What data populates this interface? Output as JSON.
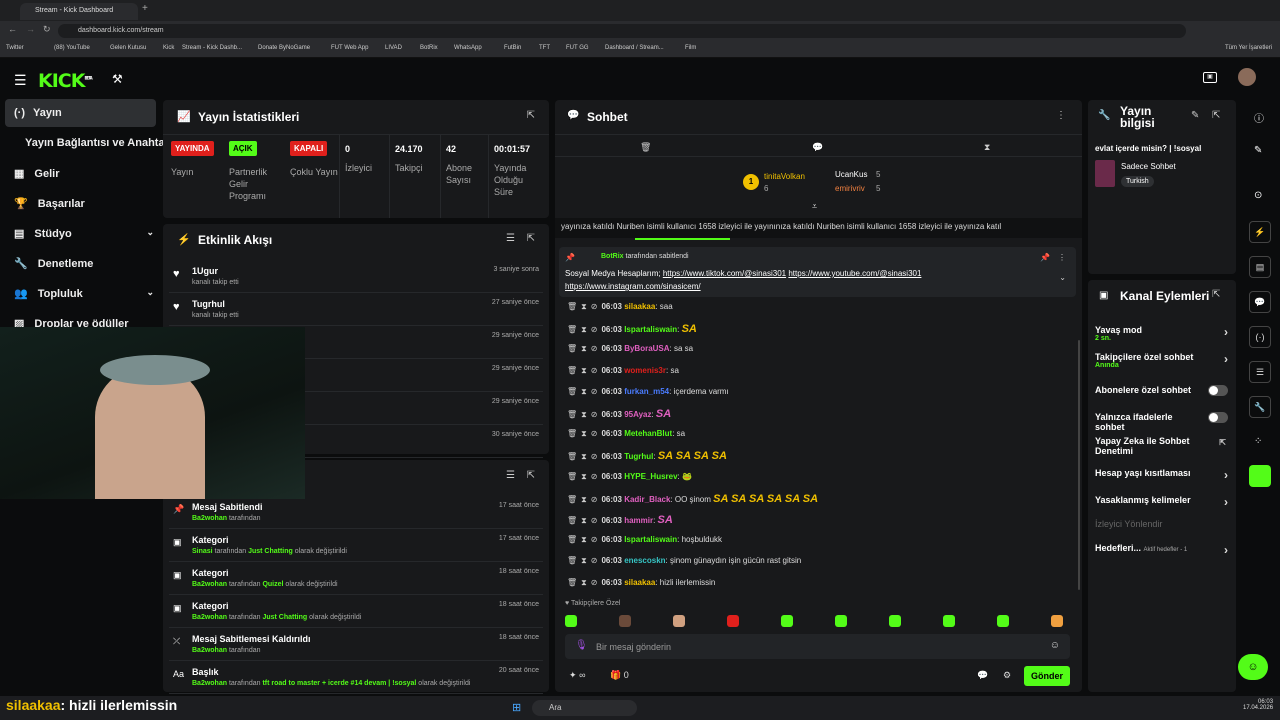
{
  "browser": {
    "tab_title": "Stream - Kick Dashboard",
    "url": "dashboard.kick.com/stream",
    "bookmarks": [
      "Twitter",
      "(88) YouTube",
      "Gelen Kutusu",
      "Kick",
      "Stream - Kick Dashb...",
      "Donate ByNoGame",
      "FUT Web App",
      "LIVAD",
      "BotRix",
      "WhatsApp",
      "FutBin",
      "TFT",
      "FUT GG",
      "Dashboard / Stream...",
      "Film"
    ],
    "all_bookmarks": "Tüm Yer İşaretleri"
  },
  "brand": {
    "logo": "KICK",
    "beta": "BETA",
    "accent": "#53fc18"
  },
  "sidebar": {
    "items": [
      {
        "label": "Yayın",
        "icon": "broadcast-icon"
      },
      {
        "label": "Yayın Bağlantısı ve Anahtarı"
      },
      {
        "label": "Gelir",
        "icon": "revenue-icon"
      },
      {
        "label": "Başarılar",
        "icon": "trophy-icon"
      },
      {
        "label": "Stüdyo",
        "icon": "studio-icon"
      },
      {
        "label": "Denetleme",
        "icon": "wrench-icon"
      },
      {
        "label": "Topluluk",
        "icon": "community-icon"
      },
      {
        "label": "Droplar ve ödüller",
        "icon": "gift-icon"
      }
    ]
  },
  "stats": {
    "title": "Yayın İstatistikleri",
    "badges": [
      {
        "badge": "YAYINDA",
        "label": "Yayın",
        "color": "#e0201c"
      },
      {
        "badge": "AÇIK",
        "label": "Partnerlik Gelir Programı",
        "color": "#53fc18"
      },
      {
        "badge": "KAPALI",
        "label": "Çoklu Yayın",
        "color": "#e0201c"
      }
    ],
    "values": [
      {
        "value": "0",
        "label": "İzleyici"
      },
      {
        "value": "24.170",
        "label": "Takipçi"
      },
      {
        "value": "42",
        "label": "Abone Sayısı"
      },
      {
        "value": "00:01:57",
        "label": "Yayında Olduğu Süre"
      }
    ]
  },
  "activity": {
    "title": "Etkinlik Akışı",
    "events": [
      {
        "name": "1Ugur",
        "sub": "kanalı takip etti",
        "time": "3 saniye sonra"
      },
      {
        "name": "Tugrhul",
        "sub": "kanalı takip etti",
        "time": "27 saniye önce"
      },
      {
        "name": "",
        "sub": "",
        "time": "29 saniye önce"
      },
      {
        "name": "",
        "sub": "",
        "time": "29 saniye önce"
      },
      {
        "name": "",
        "sub": "",
        "time": "29 saniye önce"
      },
      {
        "name": "",
        "sub": "",
        "time": "30 saniye önce"
      }
    ]
  },
  "modlog": {
    "events": [
      {
        "title": "Mesaj Sabitlendi",
        "who": "Ba2wohan",
        "rest": "tarafından",
        "extra": "",
        "tail": "",
        "time": "17 saat önce"
      },
      {
        "title": "Kategori",
        "who": "Sinasi",
        "rest": "tarafından",
        "extra": "Just Chatting",
        "tail": "olarak değiştirildi",
        "time": "17 saat önce"
      },
      {
        "title": "Kategori",
        "who": "Ba2wohan",
        "rest": "tarafından",
        "extra": "Quizel",
        "tail": "olarak değiştirildi",
        "time": "18 saat önce"
      },
      {
        "title": "Kategori",
        "who": "Ba2wohan",
        "rest": "tarafından",
        "extra": "Just Chatting",
        "tail": "olarak değiştirildi",
        "time": "18 saat önce"
      },
      {
        "title": "Mesaj Sabitlemesi Kaldırıldı",
        "who": "Ba2wohan",
        "rest": "tarafından",
        "extra": "",
        "tail": "",
        "time": "18 saat önce"
      },
      {
        "title": "Başlık",
        "who": "Ba2wohan",
        "rest": "tarafından",
        "extra": "tft road to master + icerde #14 devam | !sosyal",
        "tail": "olarak değiştirildi",
        "time": "20 saat önce"
      }
    ]
  },
  "chat": {
    "title": "Sohbet",
    "top_gifters": [
      {
        "name": "tinitaVolkan",
        "count": "6",
        "rank": "1"
      },
      {
        "name": "UcanKus",
        "count": "5"
      },
      {
        "name": "emirivriv",
        "count": "5"
      }
    ],
    "ticker": "yayınıza katıldı  Nuriben isimli kullanıcı 1658 izleyici ile yayınınıza katıldı  Nuriben isimli kullanıcı 1658 izleyici ile yayınıza katıl",
    "pinned_by": "BotRix",
    "pinned_suffix": "tarafından sabitlendi",
    "pinned_text": "Sosyal Medya Hesaplarım;",
    "pinned_link1": "https://www.tiktok.com/@sinasi301",
    "pinned_link2": "https://www.youtube.com/@sinasi301",
    "pinned_link3": "https://www.instagram.com/sinasicem/",
    "messages": [
      {
        "time": "06:03",
        "user": "silaakaa",
        "color": "#f0c000",
        "text": "saa"
      },
      {
        "time": "06:03",
        "user": "Ispartaliswain",
        "color": "#53fc18",
        "text": "SA",
        "emote": "sa"
      },
      {
        "time": "06:03",
        "user": "ByBoraUSA",
        "color": "#e060c0",
        "text": "sa sa"
      },
      {
        "time": "06:03",
        "user": "womenis3r",
        "color": "#e0201c",
        "text": "sa"
      },
      {
        "time": "06:03",
        "user": "furkan_m54",
        "color": "#4a7cff",
        "text": "içerdema varmı"
      },
      {
        "time": "06:03",
        "user": "95Ayaz",
        "color": "#e060c0",
        "text": "SA",
        "emote": "sa-p"
      },
      {
        "time": "06:03",
        "user": "MetehanBlut",
        "color": "#53fc18",
        "text": "sa"
      },
      {
        "time": "06:03",
        "user": "Tugrhul",
        "color": "#53fc18",
        "text": "SA SA SA SA",
        "emote": "sa"
      },
      {
        "time": "06:03",
        "user": "HYPE_Husrev",
        "color": "#53fc18",
        "text": "🐸"
      },
      {
        "time": "06:03",
        "user": "Kadir_Black",
        "color": "#e060c0",
        "text": "OO şinom",
        "emote_tail": "SA SA SA SA SA SA"
      },
      {
        "time": "06:03",
        "user": "hammir",
        "color": "#e060c0",
        "text": "SA",
        "emote": "sa-p"
      },
      {
        "time": "06:03",
        "user": "Ispartaliswain",
        "color": "#53fc18",
        "text": "hoşbuldukk"
      },
      {
        "time": "06:03",
        "user": "enescoskn",
        "color": "#36c5c5",
        "text": "şinom günaydın işin gücün rast gitsin"
      },
      {
        "time": "06:03",
        "user": "silaakaa",
        "color": "#f0c000",
        "text": "hizli ilerlemissin"
      }
    ],
    "followers_only": "Takipçilere Özel",
    "input_placeholder": "Bir mesaj gönderin",
    "send_label": "Gönder",
    "points": "∞",
    "gift_count": "0"
  },
  "stream_info": {
    "title": "Yayın bilgisi",
    "stream_title": "evlat içerde misin? | !sosyal",
    "category": "Sadece Sohbet",
    "tag": "Turkish"
  },
  "channel_actions": {
    "title": "Kanal Eylemleri",
    "items": [
      {
        "label": "Yavaş mod",
        "sub": "2 sn."
      },
      {
        "label": "Takipçilere özel sohbet",
        "sub": "Anında"
      },
      {
        "label": "Abonelere özel sohbet"
      },
      {
        "label": "Yalnızca ifadelerle sohbet"
      },
      {
        "label": "Yapay Zeka ile Sohbet Denetimi"
      },
      {
        "label": "Hesap yaşı kısıtlaması"
      },
      {
        "label": "Yasaklanmış kelimeler"
      },
      {
        "label": "İzleyici Yönlendir"
      },
      {
        "label": "Hedefleri...",
        "sub": "Aktif hedefler - 1"
      }
    ]
  },
  "overlay_caption": {
    "user": "silaakaa",
    "text": ": hizli ilerlemissin"
  },
  "taskbar": {
    "search": "Ara",
    "time": "06:03",
    "date": "17.04.2026"
  }
}
